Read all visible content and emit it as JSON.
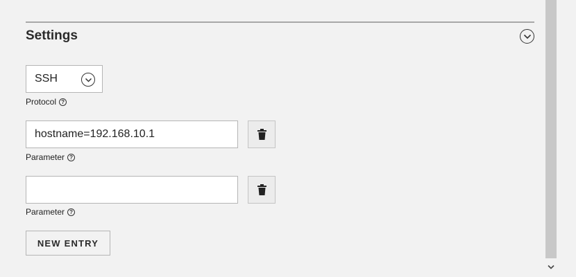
{
  "settings": {
    "title": "Settings",
    "collapse_icon": "chevron-down-circle-icon"
  },
  "protocol": {
    "value": "SSH",
    "label": "Protocol",
    "help_icon": "question-circle-icon"
  },
  "parameters": [
    {
      "value": "hostname=192.168.10.1",
      "placeholder": "",
      "label": "Parameter"
    },
    {
      "value": "",
      "placeholder": "",
      "label": "Parameter"
    }
  ],
  "actions": {
    "delete_icon": "trash-icon",
    "new_entry_label": "NEW ENTRY"
  },
  "help_glyph": "?"
}
